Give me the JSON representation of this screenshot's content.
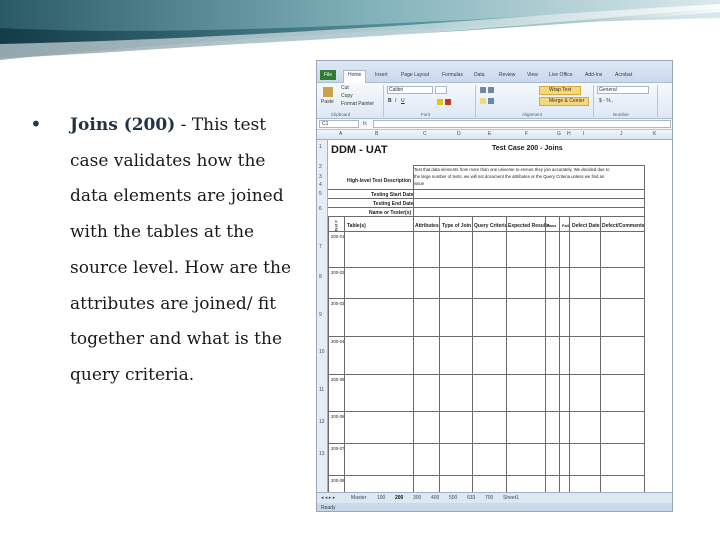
{
  "bullet": {
    "lead": "Joins (200)",
    "lines": [
      "Joins (200) - This test",
      "case validates how the",
      "data elements are joined",
      "with the tables at the",
      "source level. How are the",
      "attributes are joined/ fit",
      "together and what is the",
      "query criteria."
    ],
    "lead_rest": " - This test"
  },
  "spreadsheet": {
    "tabs": [
      "File",
      "Home",
      "Insert",
      "Page Layout",
      "Formulas",
      "Data",
      "Review",
      "View",
      "Live Office",
      "Add-Ins",
      "Acrobat"
    ],
    "ribbon": {
      "paste": "Paste",
      "cut": "Cut",
      "copy": "Copy",
      "format_painter": "Format Painter",
      "font": "Calibri",
      "wrap_text": "Wrap Text",
      "merge_center": "Merge & Center",
      "number_format": "General",
      "groups": [
        "Clipboard",
        "Font",
        "Alignment",
        "Number"
      ]
    },
    "name_box": "C1",
    "columns": [
      "A",
      "B",
      "C",
      "D",
      "E",
      "F",
      "G",
      "H",
      "I",
      "J",
      "K"
    ],
    "rows": [
      "1",
      "2",
      "3",
      "4",
      "5",
      "6",
      "7",
      "8",
      "9",
      "10",
      "11",
      "12",
      "13"
    ],
    "title": "DDM - UAT",
    "case_title": "Test Case 200 - Joins",
    "labels": {
      "description": "High-level Test Description",
      "start_date": "Testing Start Date",
      "end_date": "Testing End Date",
      "testers": "Name or Tester(s)"
    },
    "description_text": [
      "Test that data elements from more than one universe to ensure they join accurately. We decided due to",
      "the large number of tests, we will not document the attributes or the Query Criteria unless we find an",
      "issue"
    ],
    "table_headers": [
      "Test #",
      "Table(s)",
      "Attributes",
      "Type of Join",
      "Query Criteria",
      "Expected Results",
      "Pass",
      "Fail",
      "Defect Date",
      "Defect/Comments"
    ],
    "test_ids": [
      "200-01",
      "200-02",
      "200-03",
      "200-04",
      "200-05",
      "200-06",
      "200-07",
      "200-08"
    ],
    "sheet_tabs": [
      "Master",
      "100",
      "200",
      "300",
      "400",
      "500",
      "633",
      "700",
      "Sheet1"
    ],
    "status": "Ready"
  }
}
